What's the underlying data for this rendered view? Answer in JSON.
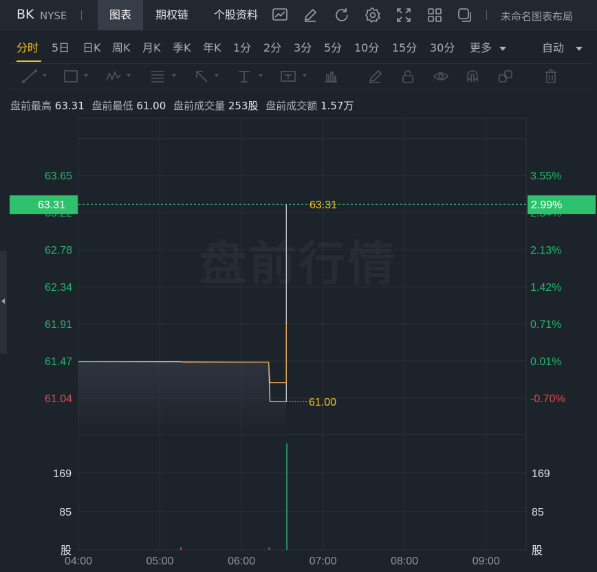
{
  "header": {
    "symbol": "BK",
    "exchange": "NYSE",
    "tabs": [
      {
        "label": "图表",
        "active": true
      },
      {
        "label": "期权链",
        "active": false
      },
      {
        "label": "个股资料",
        "active": false
      }
    ],
    "toolbar_icons": [
      "line-chart-icon",
      "pen-icon",
      "refresh-icon",
      "gear-icon",
      "fullscreen-icon",
      "grid-icon",
      "copy-icon"
    ],
    "layout_label": "未命名图表布局"
  },
  "periods": {
    "items": [
      "分时",
      "5日",
      "日K",
      "周K",
      "月K",
      "季K",
      "年K",
      "1分",
      "2分",
      "3分",
      "5分",
      "10分",
      "15分",
      "30分",
      "更多"
    ],
    "active": "分时",
    "auto_label": "自动"
  },
  "drawing_tools": [
    "trend-line-icon",
    "rectangle-icon",
    "pattern-icon",
    "fib-icon",
    "arrow-icon",
    "measure-icon",
    "text-icon",
    "bar-icon",
    "brush-icon",
    "lock-icon",
    "eye-icon",
    "magnet-icon",
    "layers-icon",
    "trash-icon"
  ],
  "stats": {
    "high_label": "盘前最高",
    "high": "63.31",
    "low_label": "盘前最低",
    "low": "61.00",
    "vol_label": "盘前成交量",
    "vol": "253股",
    "amt_label": "盘前成交额",
    "amt": "1.57万"
  },
  "watermark": "盘前行情",
  "colors": {
    "up": "#26b36b",
    "down": "#e04b4b",
    "price_line": "#e8a14b",
    "avg_line": "#c9ced6",
    "highlight": "#f5c518",
    "badge": "#2ec26e"
  },
  "chart_data": {
    "type": "line",
    "prev_close": 61.47,
    "price_axis": {
      "left_ticks": [
        "63.65",
        "63.22",
        "62.78",
        "62.34",
        "61.91",
        "61.47",
        "61.04"
      ],
      "right_ticks": [
        "3.55%",
        "2.84%",
        "2.13%",
        "1.42%",
        "0.71%",
        "0.01%",
        "-0.70%"
      ],
      "ylim": [
        61.04,
        63.65
      ]
    },
    "current_price_label": "63.31",
    "current_pct_label": "2.99%",
    "high_marker": "63.31",
    "low_marker": "61.00",
    "x_ticks": [
      "04:00",
      "05:00",
      "06:00",
      "07:00",
      "08:00",
      "09:00"
    ],
    "x_range": [
      "04:00",
      "09:30"
    ],
    "price_series": {
      "name": "",
      "x": [
        "04:00",
        "05:15",
        "05:16",
        "06:20",
        "06:21",
        "06:32",
        "06:33",
        "06:33"
      ],
      "y": [
        61.47,
        61.47,
        61.46,
        61.46,
        61.22,
        61.22,
        61.22,
        61.91
      ]
    },
    "avg_series": {
      "name": "",
      "x": [
        "04:00",
        "06:20",
        "06:21",
        "06:32",
        "06:33",
        "06:33"
      ],
      "y": [
        61.47,
        61.46,
        61.0,
        61.0,
        61.0,
        63.31
      ]
    },
    "volume": {
      "ticks": [
        "169",
        "85",
        "股"
      ],
      "ylim": [
        0,
        253
      ],
      "bars": [
        {
          "x": "05:15",
          "v": 3,
          "dir": "down"
        },
        {
          "x": "06:20",
          "v": 3,
          "dir": "down"
        },
        {
          "x": "06:33",
          "v": 253,
          "dir": "up"
        }
      ]
    }
  }
}
